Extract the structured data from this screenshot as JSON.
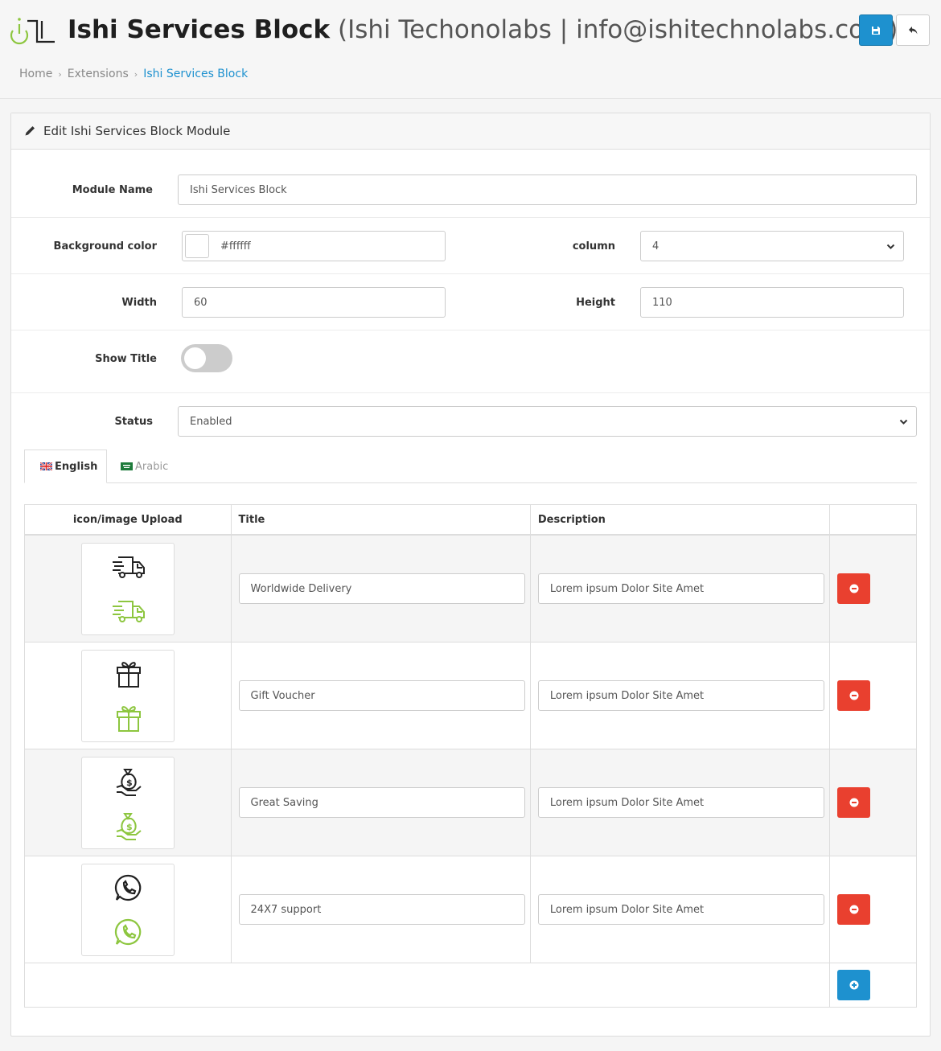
{
  "header": {
    "title_bold": "Ishi Services Block",
    "title_light": "(Ishi Techonolabs | info@ishitechnolabs.com)",
    "accent": "#1e91cf",
    "save_icon": "floppy-disk-icon",
    "back_icon": "reply-arrow-icon"
  },
  "breadcrumb": {
    "items": [
      "Home",
      "Extensions",
      "Ishi Services Block"
    ],
    "separator": "›"
  },
  "panel": {
    "heading": "Edit Ishi Services Block Module"
  },
  "form": {
    "module_name_label": "Module Name",
    "module_name_value": "Ishi Services Block",
    "bg_color_label": "Background color",
    "bg_color_value": "#ffffff",
    "column_label": "column",
    "column_value": "4",
    "width_label": "Width",
    "width_value": "60",
    "height_label": "Height",
    "height_value": "110",
    "show_title_label": "Show Title",
    "show_title_on": false,
    "status_label": "Status",
    "status_value": "Enabled"
  },
  "tabs": [
    {
      "label": "English",
      "active": true
    },
    {
      "label": "Arabic",
      "active": false
    }
  ],
  "table": {
    "headers": [
      "icon/image Upload",
      "Title",
      "Description"
    ],
    "rows": [
      {
        "icon": "delivery-truck-icon",
        "title": "Worldwide Delivery",
        "description": "Lorem ipsum Dolor Site Amet"
      },
      {
        "icon": "gift-icon",
        "title": "Gift Voucher",
        "description": "Lorem ipsum Dolor Site Amet"
      },
      {
        "icon": "money-bag-hand-icon",
        "title": "Great Saving",
        "description": "Lorem ipsum Dolor Site Amet"
      },
      {
        "icon": "whatsapp-icon",
        "title": "24X7 support",
        "description": "Lorem ipsum Dolor Site Amet"
      }
    ],
    "icon_dark": "#222222",
    "icon_green": "#8dc63f",
    "remove_color": "#e9402f",
    "add_color": "#1e91cf"
  }
}
